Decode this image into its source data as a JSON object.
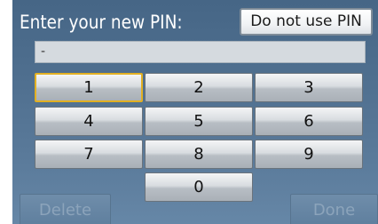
{
  "header": {
    "title": "Enter your new PIN:",
    "do_not_use_label": "Do not use PIN"
  },
  "pin_field": {
    "value": "-"
  },
  "keypad": {
    "keys": [
      "1",
      "2",
      "3",
      "4",
      "5",
      "6",
      "7",
      "8",
      "9",
      "0"
    ],
    "focused_key": "1"
  },
  "footer": {
    "delete_label": "Delete",
    "done_label": "Done"
  },
  "colors": {
    "background": "#506f8f",
    "focus_outline": "#e2b022",
    "disabled_text": "#8ca4bb"
  }
}
